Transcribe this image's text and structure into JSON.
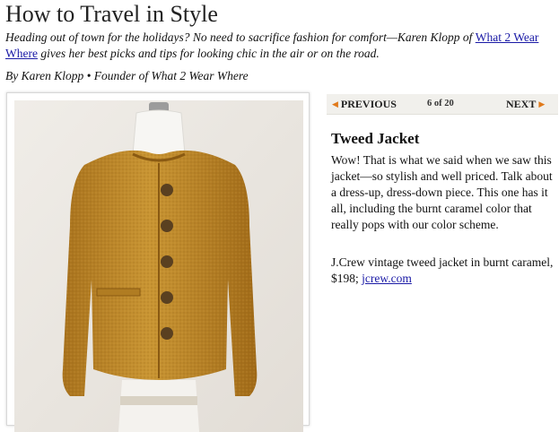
{
  "article": {
    "title": "How to Travel in Style",
    "dek_text": "Heading out of town for the holidays? No need to sacrifice fashion for comfort—Karen Klopp of ",
    "dek_link": "What 2 Wear Where",
    "dek_text_end": " gives her best picks and tips for looking chic in the air or on the road.",
    "byline": "By Karen Klopp • Founder of What 2 Wear Where"
  },
  "pager": {
    "previous_label": "PREVIOUS",
    "count": "6 of 20",
    "next_label": "NEXT"
  },
  "item": {
    "title": "Tweed Jacket",
    "description": "Wow! That is what we said when we saw this jacket—so stylish and well priced. Talk about a dress-up, dress-down piece. This one has it all, including the burnt caramel color that really pops with our color scheme.",
    "credit_text": "J.Crew vintage tweed jacket in burnt caramel, $198; ",
    "credit_link": "jcrew.com"
  },
  "colors": {
    "link": "#1a1aa6",
    "pager_arrow": "#e07a1c",
    "jacket": "#c08a2a"
  },
  "icons": {
    "prev_arrow": "triangle-left-icon",
    "next_arrow": "triangle-right-icon"
  }
}
